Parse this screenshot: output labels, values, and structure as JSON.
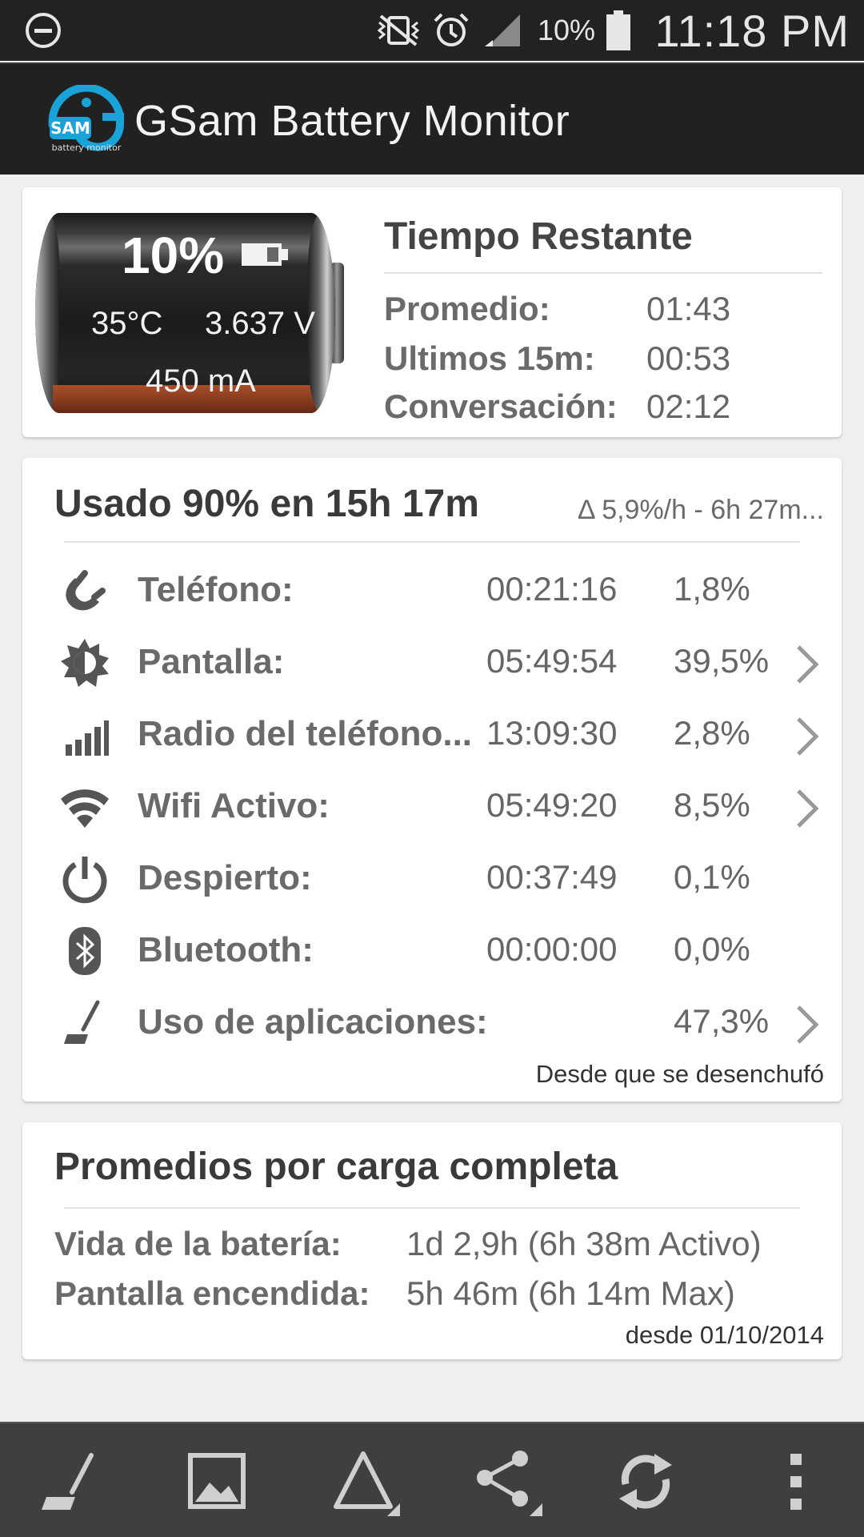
{
  "status_bar": {
    "battery_percent": "10%",
    "time": "11:18 PM",
    "icons": [
      "minus-circle-icon",
      "vibrate-mute-icon",
      "alarm-icon",
      "signal-icon",
      "battery-icon"
    ]
  },
  "app_bar": {
    "title": "GSam Battery Monitor",
    "logo_text": "SAM",
    "logo_subtext": "battery monitor"
  },
  "battery": {
    "percent": "10%",
    "temperature": "35°C",
    "voltage": "3.637 V",
    "current": "450 mA",
    "charge_fraction": 0.1
  },
  "remaining": {
    "title": "Tiempo Restante",
    "rows": [
      {
        "label": "Promedio:",
        "value": "01:43"
      },
      {
        "label": "Ultimos 15m:",
        "value": "00:53"
      },
      {
        "label": "Conversación:",
        "value": "02:12"
      }
    ]
  },
  "usage": {
    "title": "Usado 90% en 15h 17m",
    "rate": "Δ 5,9%/h - 6h 27m...",
    "rows": [
      {
        "icon": "phone-icon",
        "label": "Teléfono:",
        "time": "00:21:16",
        "percent": "1,8%",
        "has_chevron": false
      },
      {
        "icon": "brightness-icon",
        "label": "Pantalla:",
        "time": "05:49:54",
        "percent": "39,5%",
        "has_chevron": true
      },
      {
        "icon": "signal-bars-icon",
        "label": "Radio del teléfono...",
        "time": "13:09:30",
        "percent": "2,8%",
        "has_chevron": true
      },
      {
        "icon": "wifi-icon",
        "label": "Wifi Activo:",
        "time": "05:49:20",
        "percent": "8,5%",
        "has_chevron": true
      },
      {
        "icon": "power-icon",
        "label": "Despierto:",
        "time": "00:37:49",
        "percent": "0,1%",
        "has_chevron": false
      },
      {
        "icon": "bluetooth-icon",
        "label": "Bluetooth:",
        "time": "00:00:00",
        "percent": "0,0%",
        "has_chevron": false
      },
      {
        "icon": "app-usage-icon",
        "label": "Uso de aplicaciones:",
        "time": "",
        "percent": "47,3%",
        "has_chevron": true
      }
    ],
    "since": "Desde que se desenchufó"
  },
  "averages": {
    "title": "Promedios por carga completa",
    "rows": [
      {
        "label": "Vida de la batería:",
        "value": "1d 2,9h (6h 38m Activo)"
      },
      {
        "label": "Pantalla encendida:",
        "value": "5h 46m (6h 14m Max)"
      }
    ],
    "since": "desde 01/10/2014"
  },
  "toolbar": {
    "buttons": [
      "app-usage-icon",
      "image-icon",
      "delta-icon",
      "share-icon",
      "refresh-icon",
      "overflow-menu-icon"
    ]
  }
}
